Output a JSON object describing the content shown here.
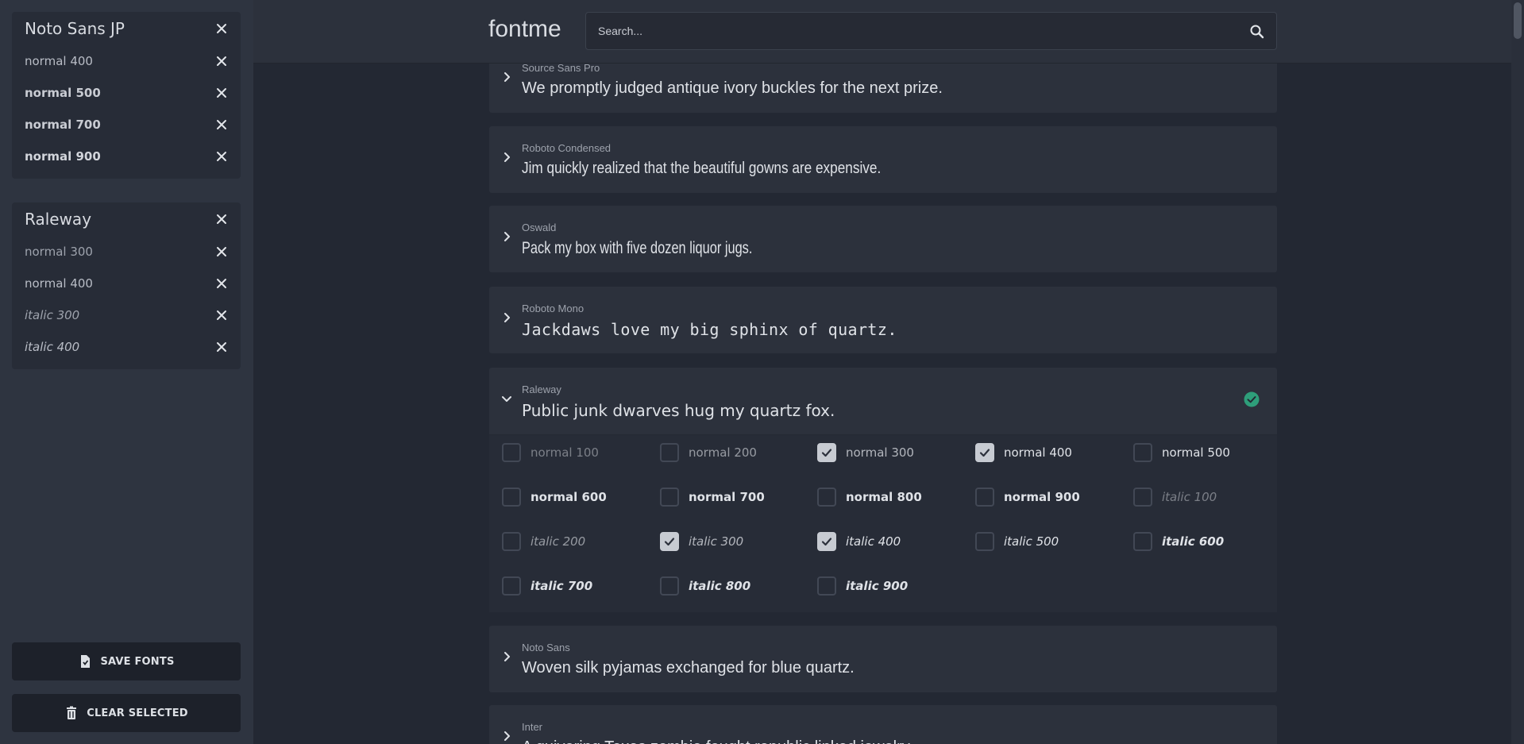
{
  "sidebar": {
    "groups": [
      {
        "font": "Noto Sans JP",
        "variants": [
          "normal 400",
          "normal 500",
          "normal 700",
          "normal 900"
        ]
      },
      {
        "font": "Raleway",
        "variants": [
          "normal 300",
          "normal 400",
          "italic 300",
          "italic 400"
        ]
      }
    ],
    "save_label": "SAVE FONTS",
    "clear_label": "CLEAR SELECTED"
  },
  "header": {
    "brand": "fontme",
    "search_placeholder": "Search..."
  },
  "fonts": [
    {
      "name": "Source Sans Pro",
      "sample": "We promptly judged antique ivory buckles for the next prize."
    },
    {
      "name": "Roboto Condensed",
      "sample": "Jim quickly realized that the beautiful gowns are expensive."
    },
    {
      "name": "Oswald",
      "sample": "Pack my box with five dozen liquor jugs."
    },
    {
      "name": "Roboto Mono",
      "sample": "Jackdaws love my big sphinx of quartz."
    },
    {
      "name": "Raleway",
      "sample": "Public junk dwarves hug my quartz fox.",
      "expanded": true,
      "selected": true
    },
    {
      "name": "Noto Sans",
      "sample": "Woven silk pyjamas exchanged for blue quartz."
    },
    {
      "name": "Inter",
      "sample": "A quivering Texas zombie fought republic linked jewelry."
    }
  ],
  "raleway_variants": [
    {
      "label": "normal 100",
      "checked": false
    },
    {
      "label": "normal 200",
      "checked": false
    },
    {
      "label": "normal 300",
      "checked": true
    },
    {
      "label": "normal 400",
      "checked": true
    },
    {
      "label": "normal 500",
      "checked": false
    },
    {
      "label": "normal 600",
      "checked": false
    },
    {
      "label": "normal 700",
      "checked": false
    },
    {
      "label": "normal 800",
      "checked": false
    },
    {
      "label": "normal 900",
      "checked": false
    },
    {
      "label": "italic 100",
      "checked": false
    },
    {
      "label": "italic 200",
      "checked": false
    },
    {
      "label": "italic 300",
      "checked": true
    },
    {
      "label": "italic 400",
      "checked": true
    },
    {
      "label": "italic 500",
      "checked": false
    },
    {
      "label": "italic 600",
      "checked": false
    },
    {
      "label": "italic 700",
      "checked": false
    },
    {
      "label": "italic 800",
      "checked": false
    },
    {
      "label": "italic 900",
      "checked": false
    }
  ],
  "colors": {
    "accent_check": "#2e9e7a",
    "background": "#232833",
    "card": "#2c313c"
  }
}
